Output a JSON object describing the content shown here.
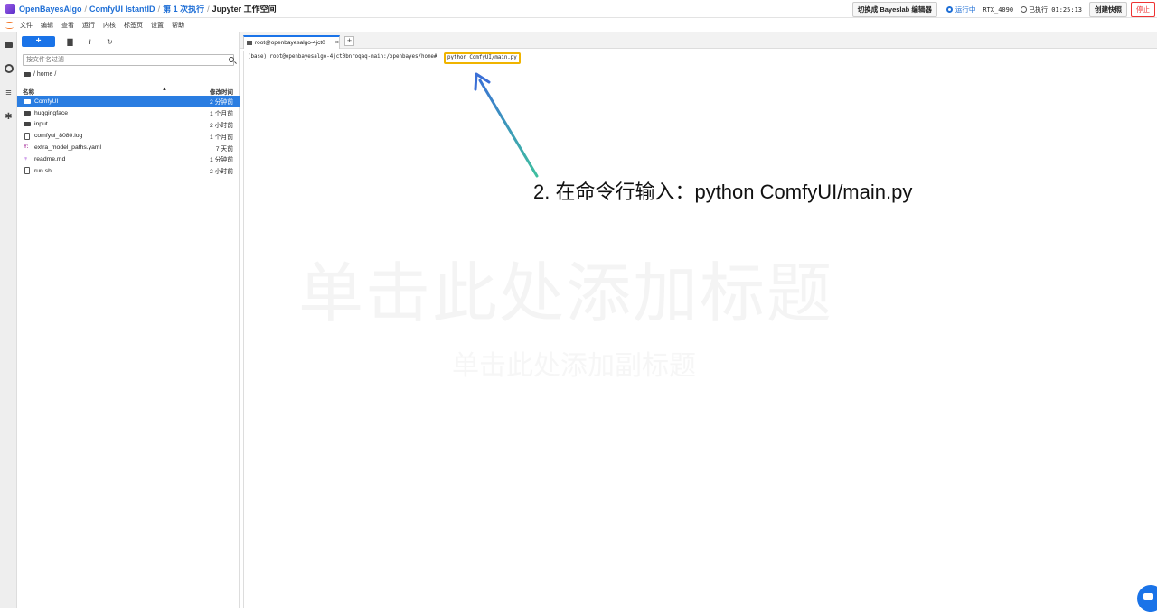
{
  "topbar": {
    "breadcrumbs": [
      "OpenBayesAlgo",
      "ComfyUI IstantID",
      "第 1 次执行"
    ],
    "separator": "/",
    "current": "Jupyter 工作空间",
    "switch_button": "切换成 Bayeslab 编辑器",
    "status": "运行中",
    "gpu": "RTX_4090",
    "elapsed": "已执行 01:25:13",
    "snapshot_button": "创建快照",
    "stop_button": "停止"
  },
  "menubar": {
    "items": [
      "文件",
      "编辑",
      "查看",
      "运行",
      "内核",
      "标签页",
      "设置",
      "帮助"
    ]
  },
  "filebrowser": {
    "new_button": "+",
    "filter_placeholder": "按文件名过滤",
    "path": "/ home /",
    "header": {
      "name": "名称",
      "modified": "修改时间"
    },
    "files": [
      {
        "name": "ComfyUI",
        "type": "folder",
        "modified": "2 分钟前",
        "selected": true
      },
      {
        "name": "huggingface",
        "type": "folder",
        "modified": "1 个月前"
      },
      {
        "name": "input",
        "type": "folder",
        "modified": "2 小时前"
      },
      {
        "name": "comfyui_8080.log",
        "type": "file",
        "modified": "1 个月前"
      },
      {
        "name": "extra_model_paths.yaml",
        "type": "yaml",
        "modified": "7 天前"
      },
      {
        "name": "readme.md",
        "type": "md",
        "modified": "1 分钟前"
      },
      {
        "name": "run.sh",
        "type": "file",
        "modified": "2 小时前"
      }
    ]
  },
  "tabs": {
    "terminal_tab": "root@openbayesalgo-4jct0",
    "close": "×",
    "add": "+"
  },
  "terminal": {
    "prompt": "(base) root@openbayesalgo-4jct0bnroqaq-main:/openbayes/home#",
    "command": "python ComfyUI/main.py"
  },
  "watermark": {
    "title": "单击此处添加标题",
    "subtitle": "单击此处添加副标题"
  },
  "annotation": {
    "text": "2. 在命令行输入：python ComfyUI/main.py",
    "arrow_color_start": "#3fbf9f",
    "arrow_color_end": "#3a6fd6",
    "highlight_color": "#f0b400"
  }
}
